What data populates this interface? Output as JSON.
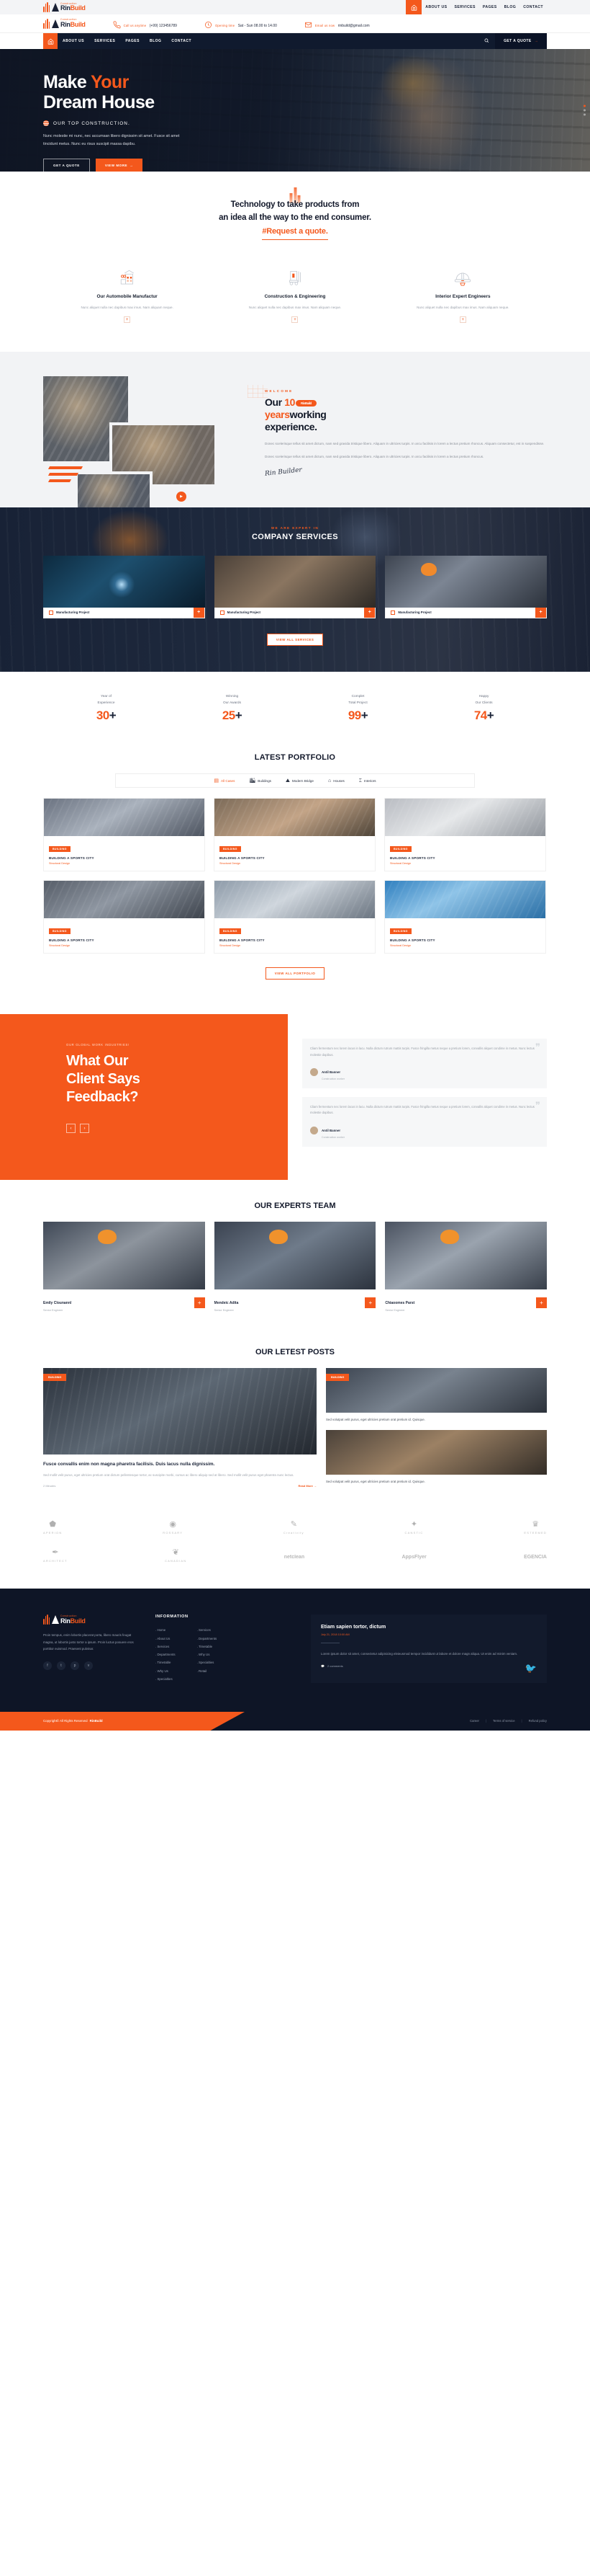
{
  "brand": {
    "name_small": "Construction",
    "name_1": "Rin",
    "name_2": "Build"
  },
  "topbar": {
    "home_icon": "home-icon",
    "menu": [
      "ABOUT US",
      "SERVICES",
      "PAGES",
      "BLOG",
      "CONTACT"
    ]
  },
  "infobar": [
    {
      "icon": "phone-icon",
      "title": "Call us anytime",
      "value": "(+99) 123456789"
    },
    {
      "icon": "clock-icon",
      "title": "Opening time",
      "value": "Sat - Sun 08.00 to 14.00"
    },
    {
      "icon": "envelope-icon",
      "title": "Email us now",
      "value": "rinbuild@gmail.com"
    }
  ],
  "mainnav": {
    "home_icon": "home-icon",
    "menu": [
      "ABOUT US",
      "SERVICES",
      "PAGES",
      "BLOG",
      "CONTACT"
    ],
    "search_icon": "search-icon",
    "quote_label": "GET A QUOTE",
    "quote_arrow": "→"
  },
  "hero": {
    "title_1": "Make ",
    "title_highlight": "Your",
    "title_2": "Dream House",
    "subtitle": "OUR TOP CONSTRUCTION.",
    "paragraph": "Nunc molestie mi nunc, nec accumsan libero dignissim sit amet. Fusce sit amet tincidunt metus. Nunc eu risus suscipit massa dapibu.",
    "btn_outline": "GET A QUOTE",
    "btn_filled": "VIEW MORE",
    "btn_filled_arrow": "→"
  },
  "tech": {
    "heading_line1": "Technology to take products from",
    "heading_line2": "an idea all the way to the end consumer.",
    "hashtag": "#Request a quote.",
    "services": [
      {
        "icon": "building-icon",
        "title": "Our Automobile Manufactur",
        "text": "Nunc aliquet nulla nec dapibus max imus. Nam aliquam neque.",
        "plus": "+"
      },
      {
        "icon": "forklift-icon",
        "title": "Construction & Engineering",
        "text": "Nunc aliquet nulla nec dapibus max imus. Nam aliquam neque.",
        "plus": "+"
      },
      {
        "icon": "helmet-icon",
        "title": "Interior Expert Engineers",
        "text": "Nunc aliquet nulla nec dapibus max imus. Nam aliquam neque.",
        "plus": "+"
      }
    ]
  },
  "welcome": {
    "eyebrow": "WELCOME",
    "title_a": "Our ",
    "title_num": "10",
    "pill": "RinBuild",
    "title_b": "years",
    "title_c": "working",
    "title_d": "experience.",
    "para1": "Donec scelerisque tellus sit amet dictum, nam sed gravida tristique libero. Aliquam in ultricies turpis. In arcu facilisis in lorem a lectus pretium rhoncus. Aliquam consectetur, est in suspendisse.",
    "para2": "Donec scelerisque tellus sit amet dictum, nam sed gravida tristique libero. Aliquam in ultricies turpis. In arcu facilisis in lorem a lectus pretium rhoncus.",
    "signature": "Rin Builder",
    "play_icon": "play-icon"
  },
  "company_services": {
    "eyebrow": "WE ARE EXPERT IN",
    "title": "COMPANY SERVICES",
    "cards": [
      {
        "label": "Manufacturing Project",
        "plus": "+"
      },
      {
        "label": "Manufacturing Project",
        "plus": "+"
      },
      {
        "label": "Manufacturing Project",
        "plus": "+"
      }
    ],
    "more_label": "VIEW ALL SERVICES"
  },
  "counters": [
    {
      "label_1": "Year of",
      "label_2": "Experience",
      "number": "30",
      "suffix": "+"
    },
    {
      "label_1": "Winning",
      "label_2": "Our Awards",
      "number": "25",
      "suffix": "+"
    },
    {
      "label_1": "Complet",
      "label_2": "Total Project",
      "number": "99",
      "suffix": "+"
    },
    {
      "label_1": "Happy",
      "label_2": "Our Clients",
      "number": "74",
      "suffix": "+"
    }
  ],
  "portfolio": {
    "title": "LATEST PORTFOLIO",
    "filters": [
      {
        "icon": "cases-icon",
        "label": "All Cases",
        "active": true
      },
      {
        "icon": "buildings-icon",
        "label": "Buildings",
        "active": false
      },
      {
        "icon": "bridge-icon",
        "label": "Modern Bridge",
        "active": false
      },
      {
        "icon": "house-icon",
        "label": "Houses",
        "active": false
      },
      {
        "icon": "interior-icon",
        "label": "Interiors",
        "active": false
      }
    ],
    "items": [
      {
        "tag": "BUILDING",
        "title": "BUILDING A SPORTS CITY",
        "subtitle": "Structural Design"
      },
      {
        "tag": "BUILDING",
        "title": "BUILDING A SPORTS CITY",
        "subtitle": "Structural Design"
      },
      {
        "tag": "BUILDING",
        "title": "BUILDING A SPORTS CITY",
        "subtitle": "Structural Design"
      },
      {
        "tag": "BUILDING",
        "title": "BUILDING A SPORTS CITY",
        "subtitle": "Structural Design"
      },
      {
        "tag": "BUILDING",
        "title": "BUILDING A SPORTS CITY",
        "subtitle": "Structural Design"
      },
      {
        "tag": "BUILDING",
        "title": "BUILDING A SPORTS CITY",
        "subtitle": "Structural Design"
      }
    ],
    "more_label": "VIEW ALL PORTFOLIO"
  },
  "testimonials": {
    "eyebrow": "OUR GLOBAL WORK INDUSTRIES!",
    "title_1": "What Our",
    "title_2": "Client Says",
    "title_3": "Feedback?",
    "prev": "‹",
    "next": "›",
    "quote_mark": "❞",
    "cards": [
      {
        "text": "Cliam fermentum nec lorem lacus in lacu. Nulla dictum rutrum mattis turpis. Fusce fringilla metus neque a pretium lorem, convallis aliquet condime in metus. Nunc lectus molestie dapibus.",
        "name": "Antil Banner",
        "role": "Construction worker"
      },
      {
        "text": "Cliam fermentum nec lorem lacus in lacu. Nulla dictum rutrum mattis turpis. Fusce fringilla metus neque a pretium lorem, convallis aliquet condime in metus. Nunc lectus molestie dapibus.",
        "name": "Antil Banner",
        "role": "Construction worker"
      }
    ]
  },
  "team": {
    "title": "OUR EXPERTS TEAM",
    "members": [
      {
        "name": "Emily Clounannl",
        "role": "Senior Engineer",
        "plus": "+"
      },
      {
        "name": "Mendeic Adita",
        "role": "Senior Engineer",
        "plus": "+"
      },
      {
        "name": "Chiaoomes Parst",
        "role": "Senior Engineer",
        "plus": "+"
      }
    ]
  },
  "posts": {
    "title": "OUR LETEST POSTS",
    "main": {
      "badge": "BUILDING",
      "title": "Fusce convallis enim non magna pharetra facilisis. Duis lacus nulla dignissim.",
      "text": "Sed mollit velit purus, eget ultricies pretium orat dictum pellentesque tortor, ac suscipite morbi, cursus ac libero aliquip sed at libero. Sed mollit velit purus eget pharetra nunc lectus.",
      "meta": "2 Minutes",
      "read_more": "Read More →"
    },
    "side": [
      {
        "badge": "BUILDING",
        "text": "Sed volutpat velit purus, eget ultricies pretium orat pretium id. Quisque."
      },
      {
        "badge": "",
        "text": "Sed volutpat velit purus, eget ultricies pretium orat pretium id. Quisque."
      }
    ]
  },
  "brands": {
    "row1": [
      {
        "icon": "shield-icon",
        "name": "APERION"
      },
      {
        "icon": "circle-icon",
        "name": "ROSSARY"
      },
      {
        "icon": "script-icon",
        "name": "Creativity"
      },
      {
        "icon": "compass-icon",
        "name": "CANSTIC"
      },
      {
        "icon": "crown-icon",
        "name": "ESTEEMED"
      }
    ],
    "row2": [
      {
        "icon": "pen-icon",
        "name": "ARCHITECT"
      },
      {
        "icon": "leaf-icon",
        "name": "CANADIAN"
      },
      {
        "icon": "",
        "name": "netclean"
      },
      {
        "icon": "",
        "name": "AppsFlyer"
      },
      {
        "icon": "",
        "name": "EGENCIA"
      }
    ]
  },
  "footer": {
    "about_text": "Proin tempus, enim lobortis placerat porta, libero mauris feugat magna, ut lobortis justo tortor a ipsum. Proin luctus posuere eros porttitor euismod. Praesent pulvinar.",
    "social": [
      "f",
      "t",
      "p",
      "v"
    ],
    "info_title": "INFORMATION",
    "links_col1": [
      "Home",
      "About Us",
      "Services",
      "Departments",
      "Timetable",
      "Why Us",
      "Specialties"
    ],
    "links_col2": [
      "Services",
      "Departments",
      "Timetable",
      "Why Us",
      "Specialties",
      "Retail"
    ],
    "post": {
      "title": "Etiam sapien tortor, dictum",
      "date": "July 21, 2018 10:00 AM",
      "text": "Lorem ipsum dolor sit amet, consectetur adipisicing eleieusmod tempor incididunt ut labore et dolore magn aliqua. Ut enim ad minim veniam.",
      "comments": "2 comments",
      "comment_icon": "comment-icon",
      "bird_icon": "twitter-bird-icon"
    },
    "copyright": "Copyright© All Rights Reserved",
    "copyright_brand": "RinBuild",
    "bottom_links": [
      "Career",
      "Terms of service",
      "Refund policy"
    ]
  },
  "colors": {
    "accent": "#f4581c",
    "dark": "#101a2e",
    "light_bg": "#f2f3f5"
  }
}
